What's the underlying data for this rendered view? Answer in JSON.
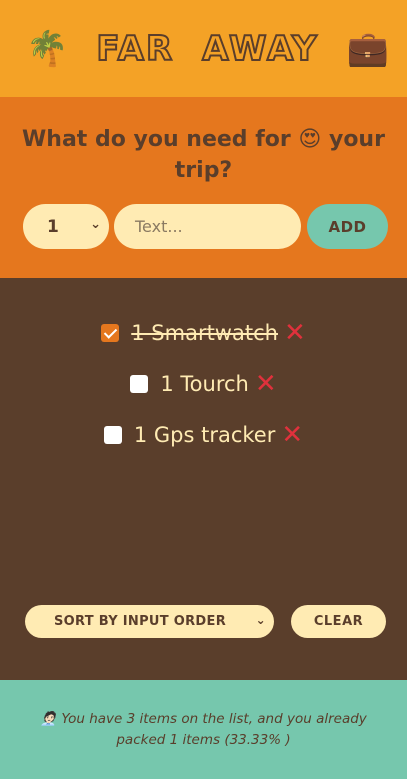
{
  "header": {
    "left_icon": "🌴",
    "title_part1": "FAR",
    "title_part2": "AWAY",
    "right_icon": "💼",
    "icon_names": [
      "palm-tree-icon",
      "briefcase-icon"
    ]
  },
  "form": {
    "question": "What do you need for 😍 your trip?",
    "quantity_selected": "1",
    "text_placeholder": "Text...",
    "add_label": "ADD"
  },
  "items": [
    {
      "quantity": 1,
      "label": "1 Smartwatch",
      "packed": true
    },
    {
      "quantity": 1,
      "label": "1 Tourch",
      "packed": false
    },
    {
      "quantity": 1,
      "label": "1 Gps tracker",
      "packed": false
    }
  ],
  "actions": {
    "sort_selected": "SORT BY INPUT ORDER",
    "clear_label": "CLEAR"
  },
  "footer": {
    "icon": "🧑🏻‍💼",
    "text_line1": "You have 3 items on the list, and you already",
    "text_line2": "packed 1 items (33.33% )"
  },
  "colors": {
    "header_bg": "#f4a226",
    "form_bg": "#e5771e",
    "list_bg": "#5a3e2b",
    "footer_bg": "#76c7ad",
    "input_bg": "#ffebb3",
    "delete": "#e0313c"
  }
}
